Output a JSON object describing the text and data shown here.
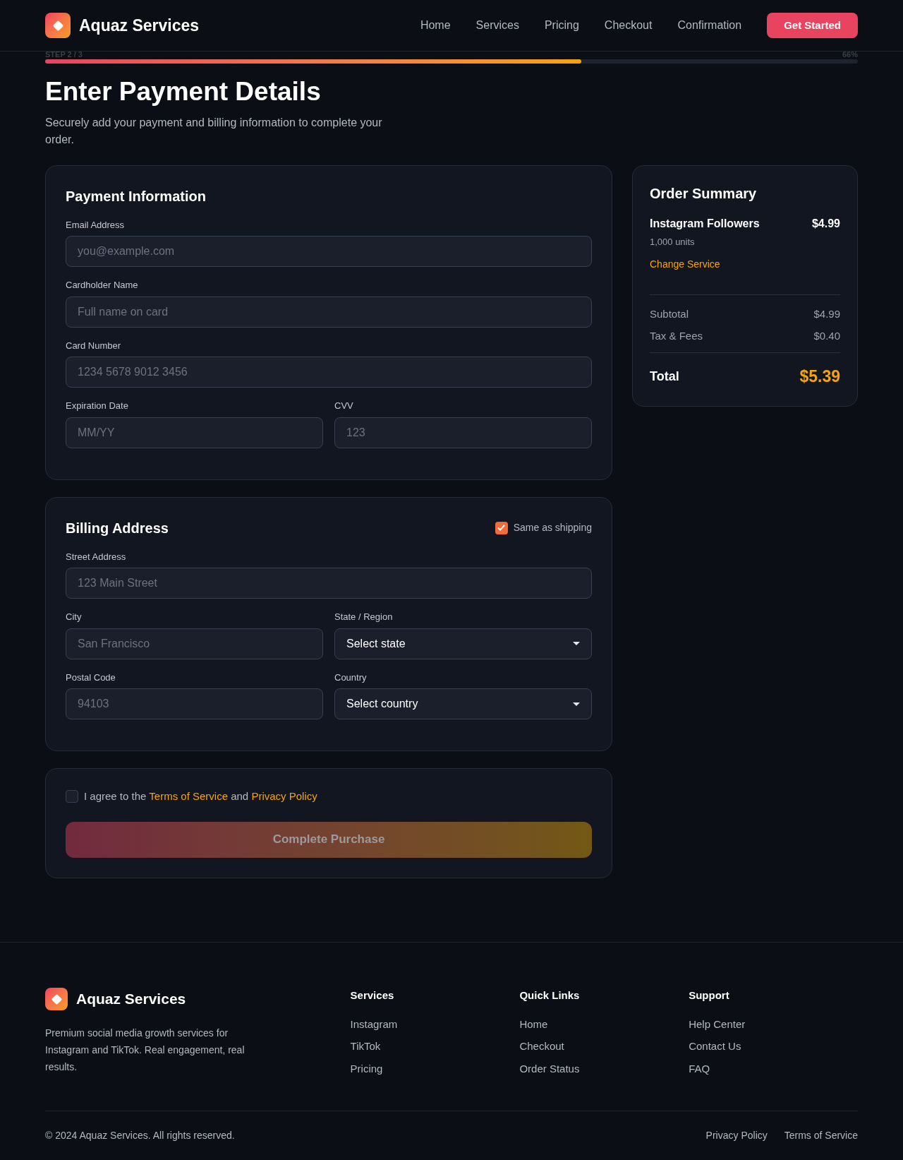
{
  "header": {
    "brand": "Aquaz Services",
    "nav": [
      {
        "label": "Home"
      },
      {
        "label": "Services"
      },
      {
        "label": "Pricing"
      },
      {
        "label": "Checkout"
      },
      {
        "label": "Confirmation"
      }
    ],
    "cta": "Get Started"
  },
  "progress": {
    "step": "STEP 2 / 3",
    "percent": "66%",
    "level": 0.66
  },
  "title": "Enter Payment Details",
  "subtitle": "Securely add your payment and billing information to complete your order.",
  "payment": {
    "title": "Payment Information",
    "rows": [
      [
        {
          "label": "Email Address",
          "placeholder": "you@example.com",
          "kind": "input"
        }
      ],
      [
        {
          "label": "Cardholder Name",
          "placeholder": "Full name on card",
          "kind": "input"
        }
      ],
      [
        {
          "label": "Card Number",
          "placeholder": "1234 5678 9012 3456",
          "kind": "input"
        }
      ],
      [
        {
          "label": "Expiration Date",
          "placeholder": "MM/YY",
          "kind": "input"
        },
        {
          "label": "CVV",
          "placeholder": "123",
          "kind": "input"
        }
      ]
    ]
  },
  "billing": {
    "title": "Billing Address",
    "same_as_shipping": {
      "label": "Same as shipping",
      "checked": true
    },
    "rows": [
      [
        {
          "label": "Street Address",
          "placeholder": "123 Main Street",
          "kind": "input"
        }
      ],
      [
        {
          "label": "City",
          "placeholder": "San Francisco",
          "kind": "input"
        },
        {
          "label": "State / Region",
          "value": "Select state",
          "kind": "select"
        }
      ],
      [
        {
          "label": "Postal Code",
          "placeholder": "94103",
          "kind": "input"
        },
        {
          "label": "Country",
          "value": "Select country",
          "kind": "select"
        }
      ]
    ]
  },
  "agreement": {
    "checked": false,
    "before": "I agree to the",
    "terms": "Terms of Service",
    "middle": "and",
    "privacy": "Privacy Policy"
  },
  "submit": {
    "label": "Complete Purchase",
    "disabled": true
  },
  "summary": {
    "title": "Order Summary",
    "item": "Instagram Followers",
    "price": "$4.99",
    "quantity": "1,000 units",
    "change": "Change Service",
    "lines": [
      {
        "label": "Subtotal",
        "value": "$4.99"
      },
      {
        "label": "Tax & Fees",
        "value": "$0.40"
      }
    ],
    "total_label": "Total",
    "total": "$5.39"
  },
  "footer": {
    "brand": "Aquaz Services",
    "description": "Premium social media growth services for Instagram and TikTok. Real engagement, real results.",
    "columns": [
      {
        "title": "Services",
        "links": [
          "Instagram",
          "TikTok",
          "Pricing"
        ]
      },
      {
        "title": "Quick Links",
        "links": [
          "Home",
          "Checkout",
          "Order Status"
        ]
      },
      {
        "title": "Support",
        "links": [
          "Help Center",
          "Contact Us",
          "FAQ"
        ]
      }
    ],
    "copyright": "© 2024 Aquaz Services. All rights reserved.",
    "legal": [
      "Privacy Policy",
      "Terms of Service"
    ]
  }
}
